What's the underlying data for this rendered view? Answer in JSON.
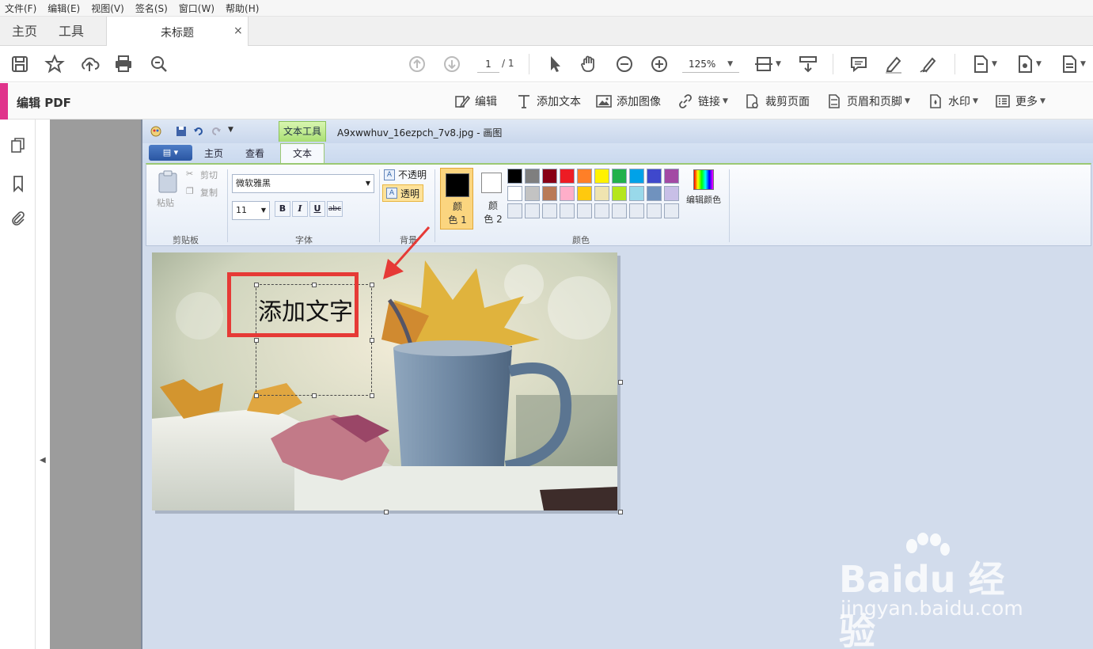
{
  "menubar": [
    "文件(F)",
    "编辑(E)",
    "视图(V)",
    "签名(S)",
    "窗口(W)",
    "帮助(H)"
  ],
  "tabs": {
    "home": "主页",
    "tools": "工具",
    "doc_title": "未标题",
    "close": "×"
  },
  "toolbar": {
    "page_current": "1",
    "page_total": "/ 1",
    "zoom": "125%"
  },
  "editbar": {
    "title": "编辑 PDF",
    "items": [
      {
        "label": "编辑",
        "icon": "edit-icon"
      },
      {
        "label": "添加文本",
        "icon": "add-text-icon"
      },
      {
        "label": "添加图像",
        "icon": "add-image-icon"
      },
      {
        "label": "链接",
        "icon": "link-icon"
      },
      {
        "label": "裁剪页面",
        "icon": "crop-page-icon"
      },
      {
        "label": "页眉和页脚",
        "icon": "header-footer-icon"
      },
      {
        "label": "水印",
        "icon": "watermark-icon"
      },
      {
        "label": "更多",
        "icon": "more-icon"
      }
    ]
  },
  "paint": {
    "context_tab": "文本工具",
    "filename": "A9xwwhuv_16ezpch_7v8.jpg - 画图",
    "tabs": {
      "home": "主页",
      "view": "查看",
      "text": "文本"
    },
    "clipboard": {
      "paste": "粘贴",
      "cut": "剪切",
      "copy": "复制",
      "label": "剪贴板"
    },
    "font": {
      "name": "微软雅黑",
      "size": "11",
      "label": "字体",
      "bold": "B",
      "italic": "I",
      "underline": "U",
      "strike": "abc"
    },
    "background": {
      "opaque": "不透明",
      "transparent": "透明",
      "label": "背景"
    },
    "colors": {
      "color1_a": "颜",
      "color1_b": "色 1",
      "color2_a": "颜",
      "color2_b": "色 2",
      "edit": "编辑颜色",
      "label": "颜色",
      "palette_row1": [
        "#000000",
        "#7f7f7f",
        "#880015",
        "#ed1c24",
        "#ff7f27",
        "#fff200",
        "#22b14c",
        "#00a2e8",
        "#3f48cc",
        "#a349a4"
      ],
      "palette_row2": [
        "#ffffff",
        "#c3c3c3",
        "#b97a57",
        "#ffaec9",
        "#ffc90e",
        "#efe4b0",
        "#b5e61d",
        "#99d9ea",
        "#7092be",
        "#c8bfe7"
      ],
      "palette_row3": [
        "#e6ebf3",
        "#e6ebf3",
        "#e6ebf3",
        "#e6ebf3",
        "#e6ebf3",
        "#e6ebf3",
        "#e6ebf3",
        "#e6ebf3",
        "#e6ebf3",
        "#e6ebf3"
      ]
    },
    "canvas_text": "添加文字"
  },
  "watermark": {
    "brand": "Baidu 经验",
    "url": "jingyan.baidu.com"
  }
}
